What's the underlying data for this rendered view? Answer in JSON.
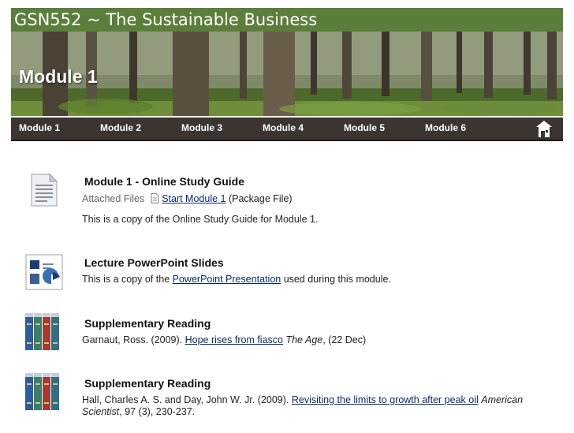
{
  "course": {
    "title": "GSN552 ~ The Sustainable Business"
  },
  "banner": {
    "title": "Module 1"
  },
  "nav": {
    "items": [
      {
        "label": "Module 1"
      },
      {
        "label": "Module 2"
      },
      {
        "label": "Module 3"
      },
      {
        "label": "Module 4"
      },
      {
        "label": "Module 5"
      },
      {
        "label": "Module 6"
      }
    ],
    "home_icon": "home-icon"
  },
  "content": {
    "study_guide": {
      "icon": "document-icon",
      "title": "Module 1 - Online Study Guide",
      "attached_label": "Attached Files",
      "file_icon": "file-icon",
      "file_link": "Start Module 1",
      "file_type": "(Package File)",
      "description": "This is a copy of the Online Study Guide for Module 1."
    },
    "lecture": {
      "icon": "presentation-icon",
      "title": "Lecture PowerPoint Slides",
      "text_before": "This is a copy of the ",
      "link": "PowerPoint Presentation",
      "text_after": " used during this module."
    },
    "reading1": {
      "icon": "books-icon",
      "title": "Supplementary Reading",
      "citation_before": "Garnaut, Ross. (2009). ",
      "link": "Hope rises from fiasco",
      "journal": "The Age",
      "citation_after": ", (22 Dec)"
    },
    "reading2": {
      "icon": "books-icon",
      "title": "Supplementary Reading",
      "citation_before": "Hall, Charles A. S. and Day, John W. Jr. (2009). ",
      "link": "Revisiting the limits to growth after peak oil",
      "journal_part1": "American",
      "journal_part2": "Scientist",
      "citation_after": ", 97 (3), 230-237."
    }
  }
}
